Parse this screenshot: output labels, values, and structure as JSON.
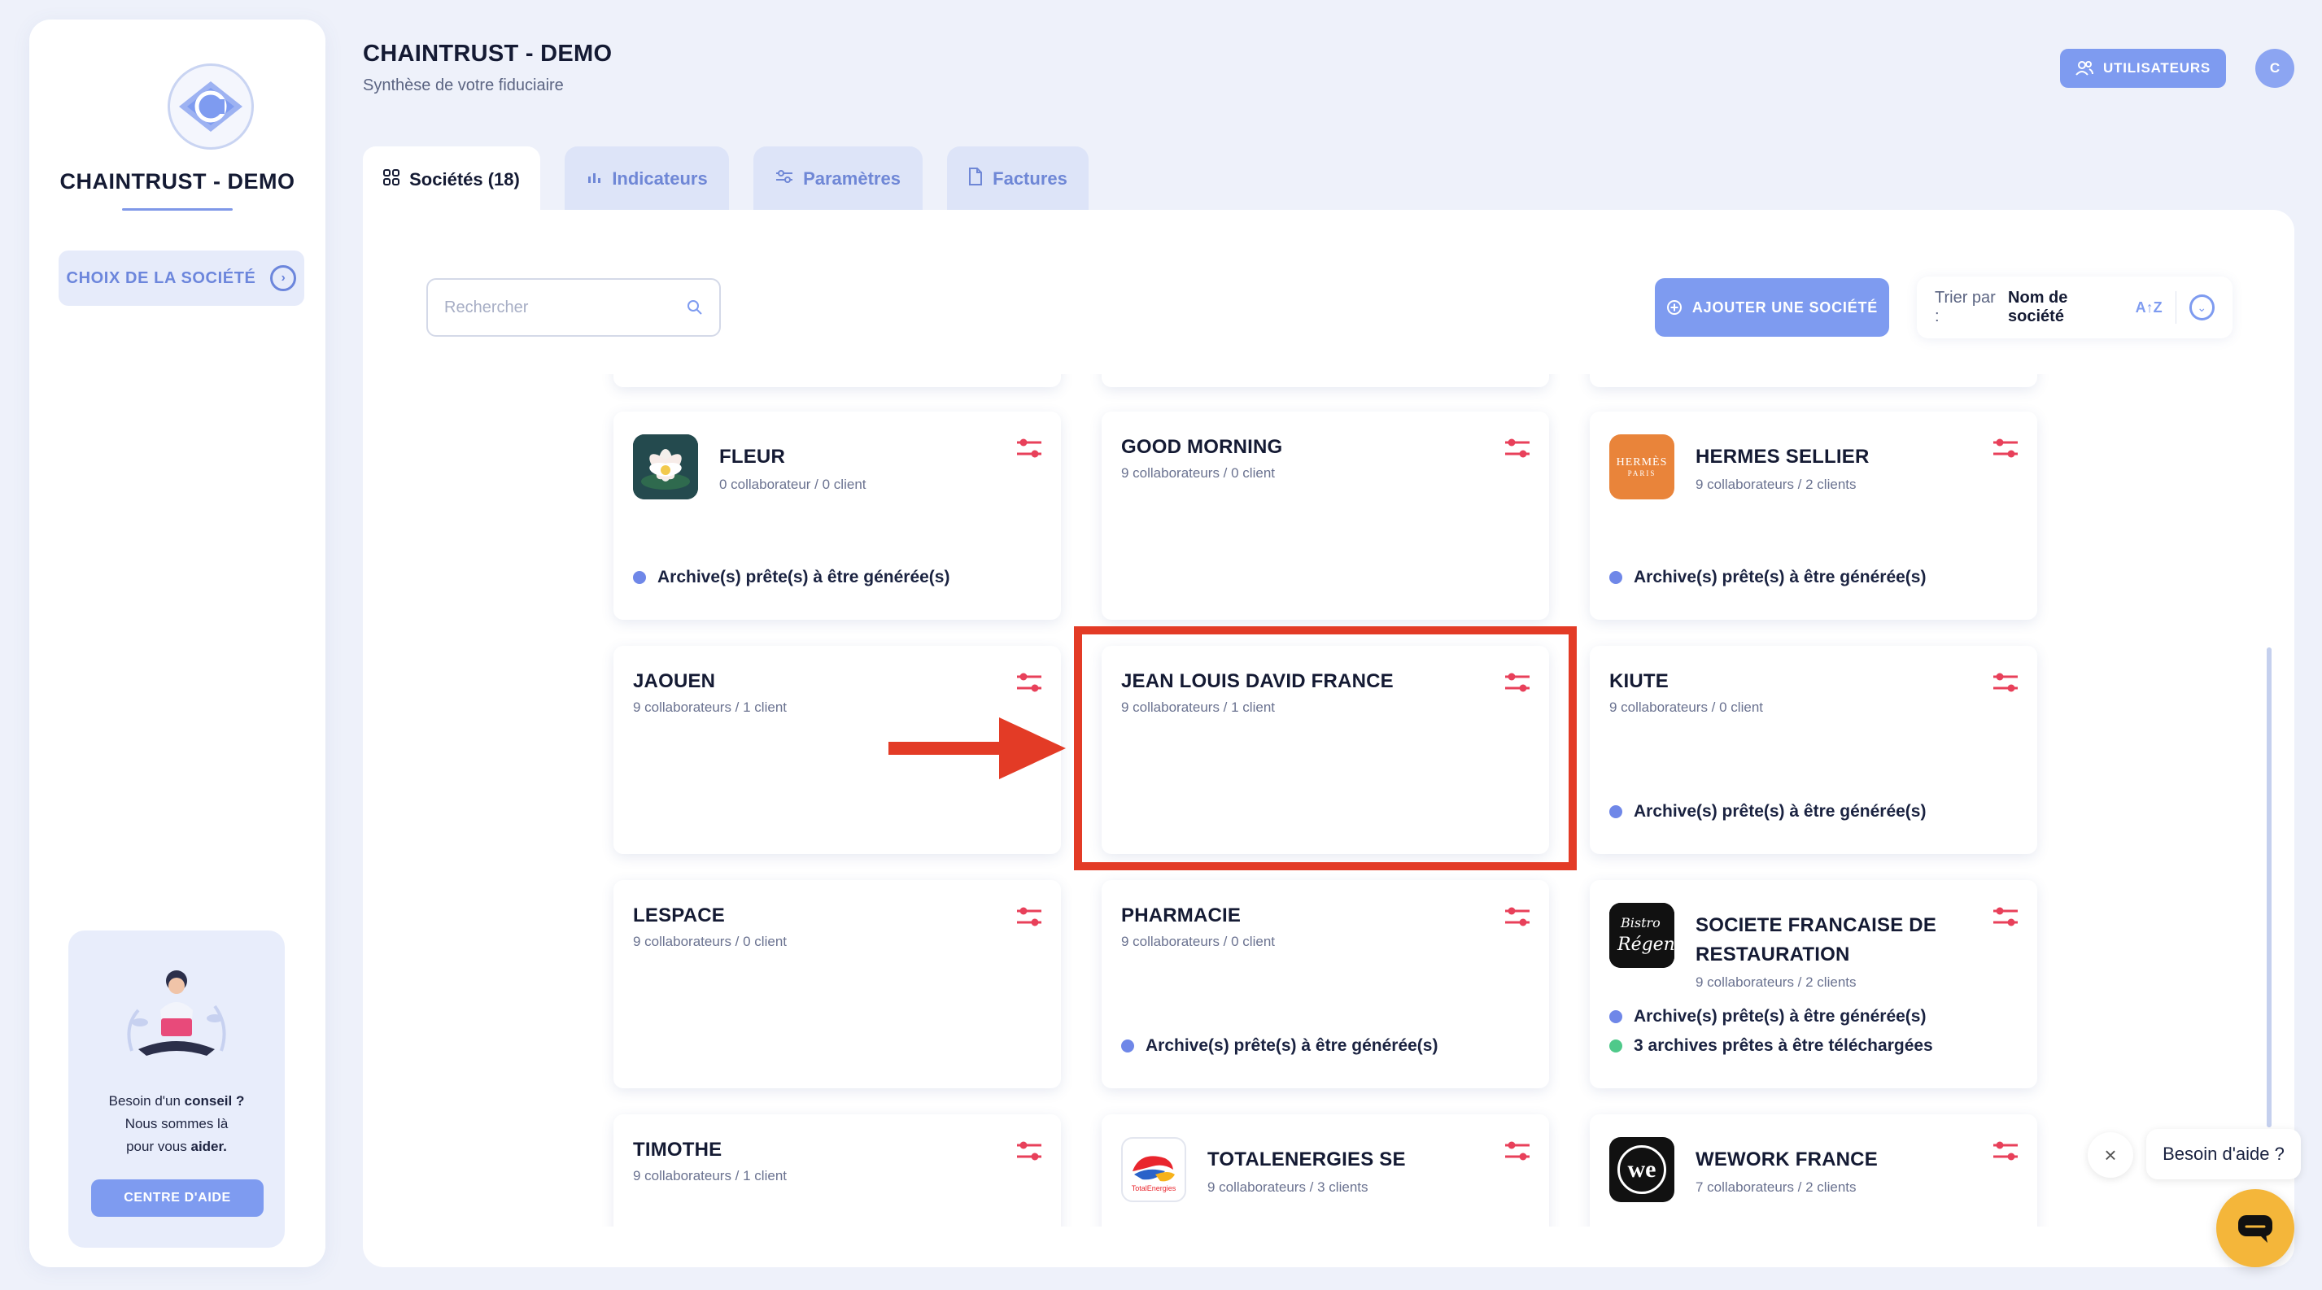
{
  "sidebar": {
    "title": "CHAINTRUST - DEMO",
    "choice_button": "CHOIX DE LA SOCIÉTÉ",
    "help": {
      "line1_a": "Besoin d'un",
      "line1_b": "conseil",
      "line1_c": " ?",
      "line2": "Nous sommes là",
      "line3_a": "pour vous",
      "line3_b": "aider.",
      "button": "CENTRE D'AIDE"
    }
  },
  "header": {
    "title": "CHAINTRUST - DEMO",
    "subtitle": "Synthèse de votre fiduciaire",
    "users_button": "UTILISATEURS",
    "avatar_initial": "C"
  },
  "tabs": [
    {
      "label": "Sociétés (18)",
      "active": true
    },
    {
      "label": "Indicateurs",
      "active": false
    },
    {
      "label": "Paramètres",
      "active": false
    },
    {
      "label": "Factures",
      "active": false
    }
  ],
  "toolbar": {
    "search_placeholder": "Rechercher",
    "add_button": "AJOUTER UNE SOCIÉTÉ",
    "sort_label": "Trier par :",
    "sort_value": "Nom de société",
    "sort_icon_text": "A↑Z"
  },
  "companies": [
    {
      "name": "FLEUR",
      "meta": "0 collaborateur / 0 client",
      "status": [
        "Archive(s) prête(s) à être générée(s)"
      ]
    },
    {
      "name": "GOOD MORNING",
      "meta": "9 collaborateurs / 0 client",
      "status": []
    },
    {
      "name": "HERMES SELLIER",
      "meta": "9 collaborateurs / 2 clients",
      "status": [
        "Archive(s) prête(s) à être générée(s)"
      ]
    },
    {
      "name": "JAOUEN",
      "meta": "9 collaborateurs / 1 client",
      "status": []
    },
    {
      "name": "JEAN LOUIS DAVID FRANCE",
      "meta": "9 collaborateurs / 1 client",
      "status": []
    },
    {
      "name": "KIUTE",
      "meta": "9 collaborateurs / 0 client",
      "status": [
        "Archive(s) prête(s) à être générée(s)"
      ]
    },
    {
      "name": "LESPACE",
      "meta": "9 collaborateurs / 0 client",
      "status": []
    },
    {
      "name": "PHARMACIE",
      "meta": "9 collaborateurs / 0 client",
      "status": [
        "Archive(s) prête(s) à être générée(s)"
      ]
    },
    {
      "name_line1": "SOCIETE FRANCAISE DE",
      "name_line2": "RESTAURATION",
      "meta": "9 collaborateurs / 2 clients",
      "status": [
        "Archive(s) prête(s) à être générée(s)",
        "3 archives prêtes à être téléchargées"
      ]
    },
    {
      "name": "TIMOTHE",
      "meta": "9 collaborateurs / 1 client",
      "status": []
    },
    {
      "name": "TOTALENERGIES SE",
      "meta": "9 collaborateurs / 3 clients",
      "status": []
    },
    {
      "name": "WEWORK FRANCE",
      "meta": "7 collaborateurs / 2 clients",
      "status": []
    }
  ],
  "logos": {
    "hermes_line1": "HERMÈS",
    "hermes_line2": "PARIS",
    "total_text": "TotalEnergies",
    "wework_text": "we"
  },
  "chat": {
    "bubble": "Besoin d'aide ?"
  },
  "colors": {
    "accent": "#7e9bf0",
    "highlight": "#e33b26",
    "status_blue": "#6f87e8",
    "status_green": "#4fc98a",
    "settings_red": "#e8405a"
  }
}
